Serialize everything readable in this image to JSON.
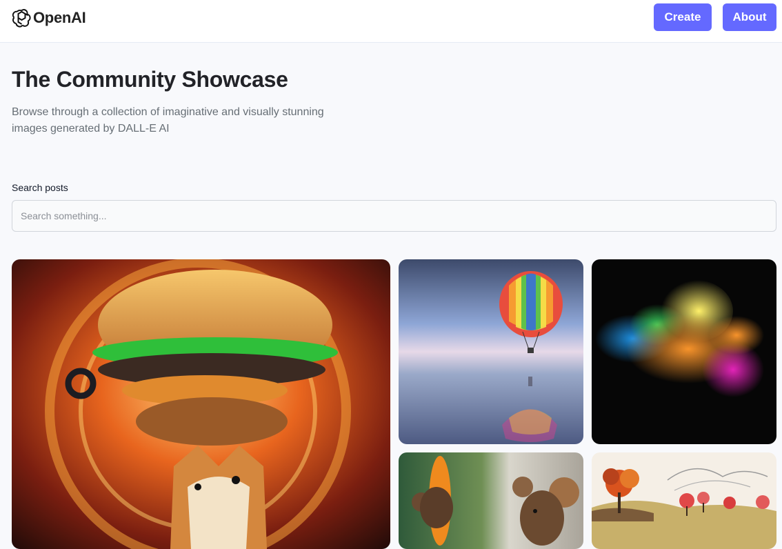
{
  "header": {
    "logo_text": "OpenAI",
    "create_label": "Create",
    "about_label": "About"
  },
  "hero": {
    "title": "The Community Showcase",
    "subtitle": "Browse through a collection of imaginative and visually stunning images generated by DALL-E AI"
  },
  "search": {
    "label": "Search posts",
    "placeholder": "Search something...",
    "value": ""
  },
  "gallery": {
    "items": [
      {
        "subject": "burger-doge-painting"
      },
      {
        "subject": "rainbow-hot-air-balloon"
      },
      {
        "subject": "color-powder-explosion"
      },
      {
        "subject": "mice-with-surfboard"
      },
      {
        "subject": "autumn-trees-sketch"
      }
    ]
  },
  "colors": {
    "accent": "#6469ff",
    "background": "#f8f9fc",
    "title": "#222328",
    "subtitle": "#666e75"
  }
}
